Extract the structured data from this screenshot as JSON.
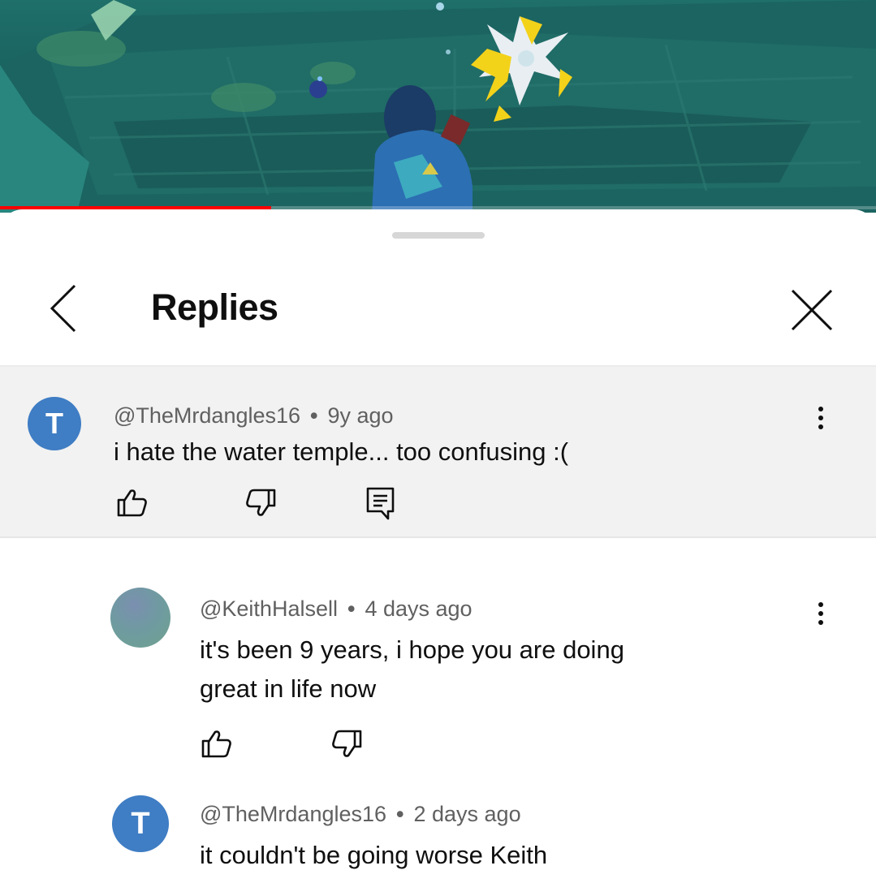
{
  "video": {
    "progress_fraction": 0.31
  },
  "sheet": {
    "title": "Replies",
    "back_icon": "chevron-left-icon",
    "close_icon": "close-icon"
  },
  "parent_comment": {
    "avatar_letter": "T",
    "avatar_color": "#3f7dc4",
    "author": "@TheMrdangles16",
    "separator": "•",
    "time": "9y ago",
    "text": "i hate the water temple... too confusing :(",
    "actions": [
      "like-icon",
      "dislike-icon",
      "reply-icon"
    ]
  },
  "replies": [
    {
      "author": "@KeithHalsell",
      "separator": "•",
      "time": "4 days ago",
      "text_line1": "it's been 9 years, i hope you are doing",
      "text_line2": "great in life now",
      "actions": [
        "like-icon",
        "dislike-icon"
      ]
    },
    {
      "avatar_letter": "T",
      "avatar_color": "#3f7dc4",
      "author": "@TheMrdangles16",
      "separator": "•",
      "time": "2 days ago",
      "text": "it couldn't be going worse Keith"
    }
  ]
}
